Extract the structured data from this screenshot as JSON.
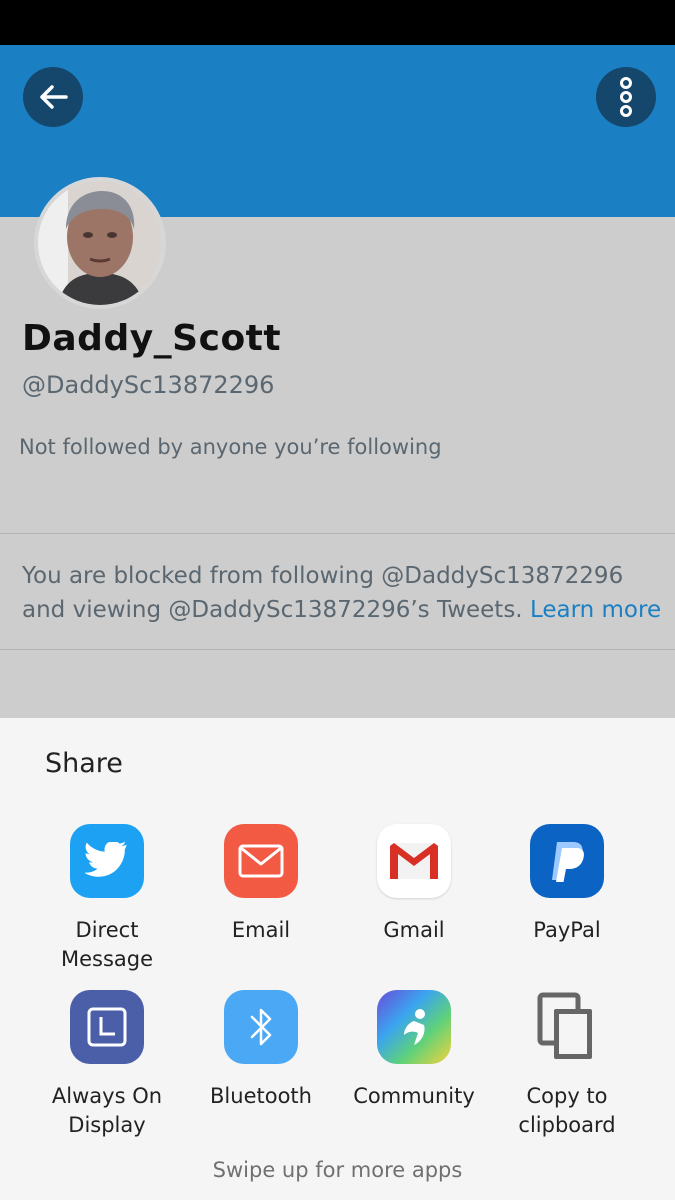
{
  "profile": {
    "display_name": "Daddy_Scott",
    "handle": "@DaddySc13872296",
    "follow_note": "Not followed by anyone you’re following",
    "blocked_message": "You are blocked from following @DaddySc13872296 and viewing @DaddySc13872296’s Tweets.",
    "learn_more": "Learn more"
  },
  "share_sheet": {
    "title": "Share",
    "apps": [
      {
        "label": "Direct Message",
        "icon": "twitter-bird-icon"
      },
      {
        "label": "Email",
        "icon": "email-icon"
      },
      {
        "label": "Gmail",
        "icon": "gmail-icon"
      },
      {
        "label": "PayPal",
        "icon": "paypal-icon"
      },
      {
        "label": "Always On Display",
        "icon": "always-on-display-icon"
      },
      {
        "label": "Bluetooth",
        "icon": "bluetooth-icon"
      },
      {
        "label": "Community",
        "icon": "community-icon"
      },
      {
        "label": "Copy to clipboard",
        "icon": "copy-icon"
      }
    ],
    "swipe_hint": "Swipe up for more apps"
  },
  "colors": {
    "header": "#1b80c3",
    "link": "#1b80c3",
    "twitter": "#1da1f2",
    "email": "#f25a43",
    "paypal": "#0b63c4",
    "always_on_display": "#4b5ea8",
    "bluetooth": "#4aa8f5"
  }
}
